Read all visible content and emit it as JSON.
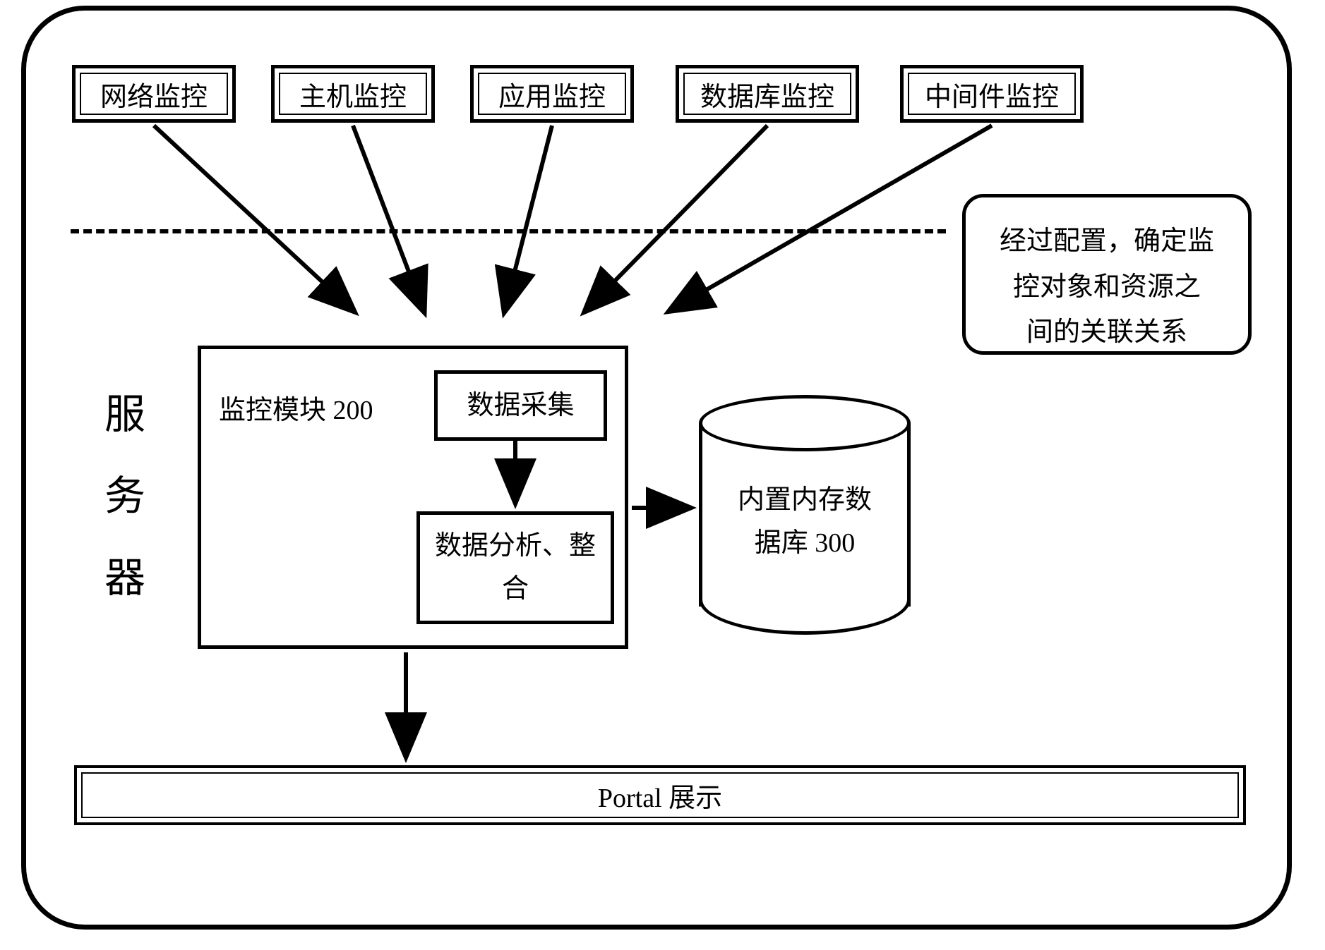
{
  "diagram": {
    "top_boxes": [
      {
        "label": "网络监控"
      },
      {
        "label": "主机监控"
      },
      {
        "label": "应用监控"
      },
      {
        "label": "数据库监控"
      },
      {
        "label": "中间件监控"
      }
    ],
    "config_note": "经过配置，确定监\n控对象和资源之\n间的关联关系",
    "server_label": "服\n务\n器",
    "module_title": "监控模块 200",
    "sub_collect": "数据采集",
    "sub_analyze": "数据分析、整\n合",
    "database_label": "内置内存数\n据库 300",
    "portal_label": "Portal 展示"
  }
}
